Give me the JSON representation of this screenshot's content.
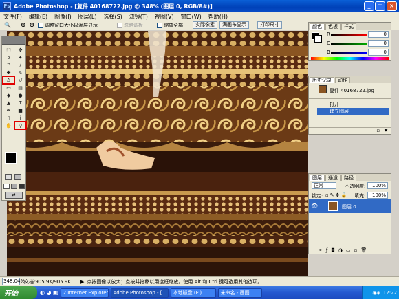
{
  "window": {
    "title": "Adobe Photoshop - [复件 40168722.jpg @ 348% (图层 0, RGB/8#)]",
    "minimize": "_",
    "maximize": "□",
    "close": "×"
  },
  "menu": [
    "文件(F)",
    "编辑(E)",
    "图像(I)",
    "图层(L)",
    "选择(S)",
    "滤镜(T)",
    "视图(V)",
    "窗口(W)",
    "帮助(H)"
  ],
  "options": {
    "zoom_glyph": "🔍",
    "resize_window": "调整窗口大小以满屏显示",
    "ignore_palettes": "忽略调板",
    "zoom_all": "缩放全部",
    "actual_pixels": "实际像素",
    "fit_screen": "满画布显示",
    "print_size": "打印尺寸"
  },
  "color_panel": {
    "tabs": [
      "颜色",
      "色板",
      "样式"
    ],
    "channels": [
      {
        "label": "R",
        "value": "0",
        "color": "#ff0000"
      },
      {
        "label": "G",
        "value": "0",
        "color": "#00aa00"
      },
      {
        "label": "B",
        "value": "0",
        "color": "#0000ff"
      }
    ]
  },
  "history_panel": {
    "tabs": [
      "历史记录",
      "动作"
    ],
    "snapshot": "复件 40168722.jpg",
    "items": [
      {
        "label": "打开",
        "selected": false
      },
      {
        "label": "建立图层",
        "selected": true
      }
    ]
  },
  "layers_panel": {
    "tabs": [
      "图层",
      "通道",
      "路径"
    ],
    "blend_mode": "正常",
    "opacity_label": "不透明度:",
    "opacity": "100%",
    "lock_label": "锁定:",
    "fill_label": "填充:",
    "fill": "100%",
    "layer": "图层 0"
  },
  "status": {
    "zoom": "348.04%",
    "doc": "文档:905.9K/905.9K",
    "hint": "点按图像以放大；点按并拖移以用选框缩放。使用 Alt 和 Ctrl 键可选用其他选项。"
  },
  "taskbar": {
    "start": "开始",
    "items": [
      {
        "label": "2 Internet Explorer",
        "active": false
      },
      {
        "label": "Adobe Photoshop - [...",
        "active": true
      },
      {
        "label": "本地磁盘 (F:)",
        "active": false
      },
      {
        "label": "未命名 - 画图",
        "active": false
      }
    ],
    "clock": "12:22"
  },
  "colors": {
    "titlebar": "#0041b8",
    "highlight": "#316ac5",
    "tool_highlight": "#e00000"
  }
}
